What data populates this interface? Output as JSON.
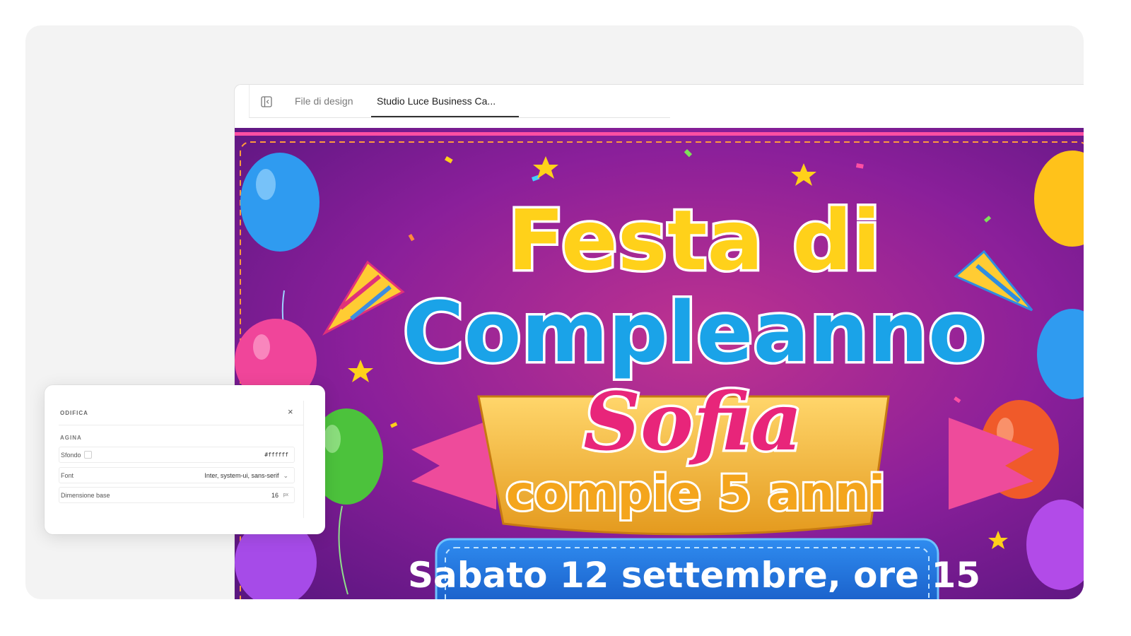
{
  "tabs": {
    "items": [
      {
        "label": "File di design"
      },
      {
        "label": "Studio Luce Business Ca..."
      }
    ]
  },
  "flyer": {
    "title_line1": "Festa di",
    "title_line2": "Compleanno",
    "name": "Sofia",
    "subtitle": "compie 5 anni",
    "date": "Sabato 12 settembre, ore 15"
  },
  "panel": {
    "title": "ODIFICA",
    "close": "×",
    "section": "AGINA",
    "rows": {
      "background": {
        "label": "Sfondo",
        "value": "#ffffff"
      },
      "font": {
        "label": "Font",
        "value": "Inter, system-ui, sans-serif"
      },
      "base_size": {
        "label": "Dimensione base",
        "value": "16",
        "unit": "px"
      }
    }
  },
  "colors": {
    "canvas_bg": "#8a1f9a",
    "title_yellow": "#ffd11a",
    "title_blue": "#1aa3e8",
    "name_pink": "#e8257a",
    "ribbon_gold": "#f2b93a",
    "date_blue": "#1e6fd6"
  }
}
